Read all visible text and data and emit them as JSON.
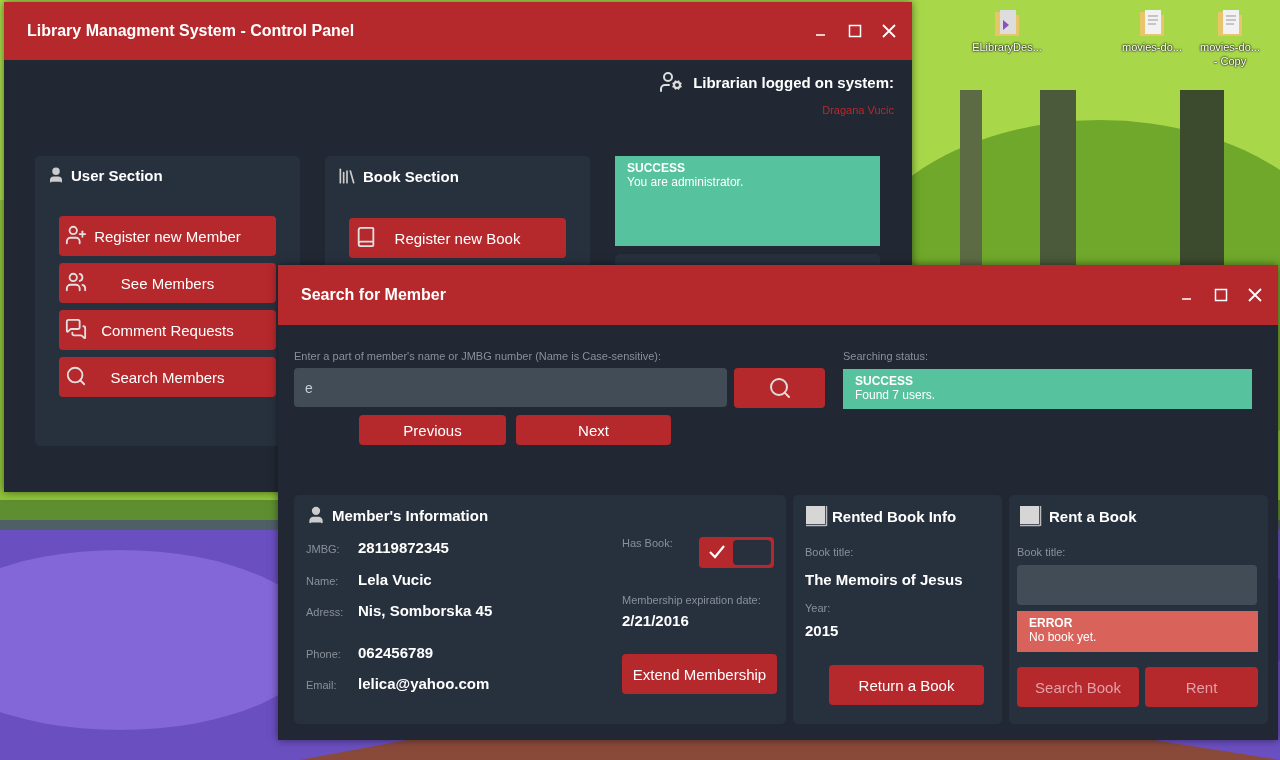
{
  "desktop": {
    "icons": [
      {
        "label": "ELibraryDes...",
        "kind": "project"
      },
      {
        "label": "movies-do...",
        "kind": "folder"
      },
      {
        "label": "movies-do... - Copy",
        "kind": "folder"
      }
    ]
  },
  "main_window": {
    "title": "Library Managment System - Control Panel",
    "librarian": {
      "label": "Librarian logged on system:",
      "name": "Dragana Vucic"
    },
    "user_section": {
      "title": "User Section",
      "buttons": [
        {
          "label": "Register new Member"
        },
        {
          "label": "See Members"
        },
        {
          "label": "Comment Requests"
        },
        {
          "label": "Search Members"
        }
      ]
    },
    "book_section": {
      "title": "Book Section",
      "buttons": [
        {
          "label": "Register new Book"
        }
      ]
    },
    "notice": {
      "kind": "success",
      "status": "SUCCESS",
      "message": "You are administrator."
    }
  },
  "search_window": {
    "title": "Search for Member",
    "search": {
      "label": "Enter a part of member's name or JMBG number (Name is Case-sensitive):",
      "value": "e"
    },
    "status": {
      "label": "Searching status:",
      "kind": "success",
      "status": "SUCCESS",
      "message": "Found 7 users."
    },
    "nav_buttons": [
      "Previous",
      "Next"
    ],
    "member_info": {
      "title": "Member's Information",
      "fields": [
        {
          "label": "JMBG:",
          "value": "28119872345"
        },
        {
          "label": "Name:",
          "value": "Lela Vucic"
        },
        {
          "label": "Adress:",
          "value": "Nis, Somborska 45"
        },
        {
          "label": "Phone:",
          "value": "062456789"
        },
        {
          "label": "Email:",
          "value": "lelica@yahoo.com"
        }
      ],
      "has_book": {
        "label": "Has Book:",
        "checked": true
      },
      "expiration": {
        "label": "Membership expiration date:",
        "value": "2/21/2016"
      },
      "button": "Extend Membership"
    },
    "rented_book": {
      "title": "Rented Book Info",
      "fields": [
        {
          "label": "Book title:",
          "value": "The Memoirs of Jesus"
        },
        {
          "label": "Year:",
          "value": "2015"
        }
      ],
      "button": "Return a Book"
    },
    "rent_book": {
      "title": "Rent a Book",
      "field_label": "Book title:",
      "notice": {
        "kind": "error",
        "status": "ERROR",
        "message": "No book yet."
      },
      "buttons": [
        {
          "label": "Search Book",
          "disabled": true
        },
        {
          "label": "Rent",
          "disabled": true
        }
      ]
    }
  }
}
